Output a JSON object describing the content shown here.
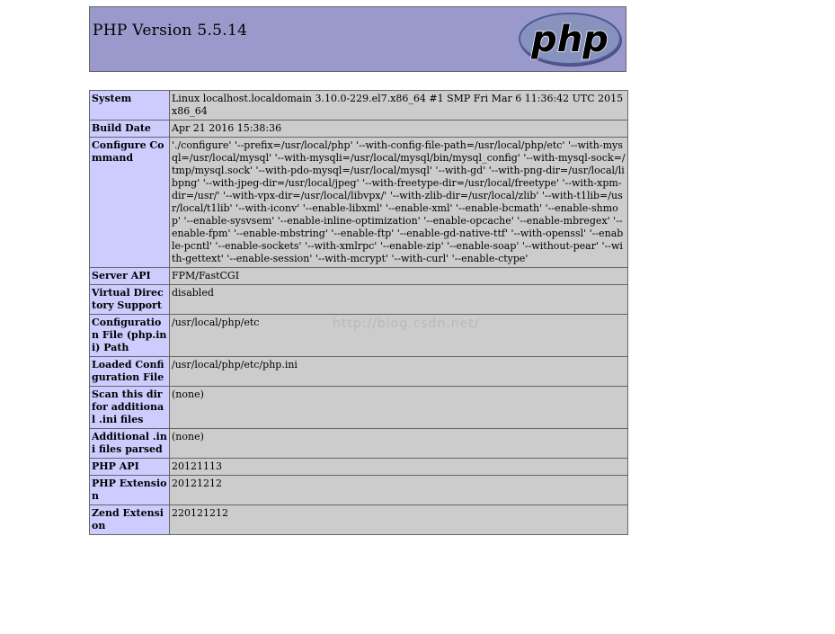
{
  "header": {
    "title": "PHP Version 5.5.14",
    "logo_text": "php"
  },
  "colors": {
    "header_bg": "#9999cc",
    "label_bg": "#ccccff",
    "value_bg": "#cccccc",
    "border": "#666666"
  },
  "rows": [
    {
      "label": "System",
      "value": "Linux localhost.localdomain 3.10.0-229.el7.x86_64 #1 SMP Fri Mar 6 11:36:42 UTC 2015 x86_64"
    },
    {
      "label": "Build Date",
      "value": "Apr 21 2016 15:38:36"
    },
    {
      "label": "Configure Command",
      "value": "'./configure' '--prefix=/usr/local/php' '--with-config-file-path=/usr/local/php/etc' '--with-mysql=/usr/local/mysql' '--with-mysqli=/usr/local/mysql/bin/mysql_config' '--with-mysql-sock=/tmp/mysql.sock' '--with-pdo-mysql=/usr/local/mysql' '--with-gd' '--with-png-dir=/usr/local/libpng' '--with-jpeg-dir=/usr/local/jpeg' '--with-freetype-dir=/usr/local/freetype' '--with-xpm-dir=/usr/' '--with-vpx-dir=/usr/local/libvpx/' '--with-zlib-dir=/usr/local/zlib' '--with-t1lib=/usr/local/t1lib' '--with-iconv' '--enable-libxml' '--enable-xml' '--enable-bcmath' '--enable-shmop' '--enable-sysvsem' '--enable-inline-optimization' '--enable-opcache' '--enable-mbregex' '--enable-fpm' '--enable-mbstring' '--enable-ftp' '--enable-gd-native-ttf' '--with-openssl' '--enable-pcntl' '--enable-sockets' '--with-xmlrpc' '--enable-zip' '--enable-soap' '--without-pear' '--with-gettext' '--enable-session' '--with-mcrypt' '--with-curl' '--enable-ctype'"
    },
    {
      "label": "Server API",
      "value": "FPM/FastCGI"
    },
    {
      "label": "Virtual Directory Support",
      "value": "disabled"
    },
    {
      "label": "Configuration File (php.ini) Path",
      "value": "/usr/local/php/etc"
    },
    {
      "label": "Loaded Configuration File",
      "value": "/usr/local/php/etc/php.ini"
    },
    {
      "label": "Scan this dir for additional .ini files",
      "value": "(none)"
    },
    {
      "label": "Additional .ini files parsed",
      "value": "(none)"
    },
    {
      "label": "PHP API",
      "value": "20121113"
    },
    {
      "label": "PHP Extension",
      "value": "20121212"
    },
    {
      "label": "Zend Extension",
      "value": "220121212"
    }
  ],
  "watermark": "http://blog.csdn.net/"
}
